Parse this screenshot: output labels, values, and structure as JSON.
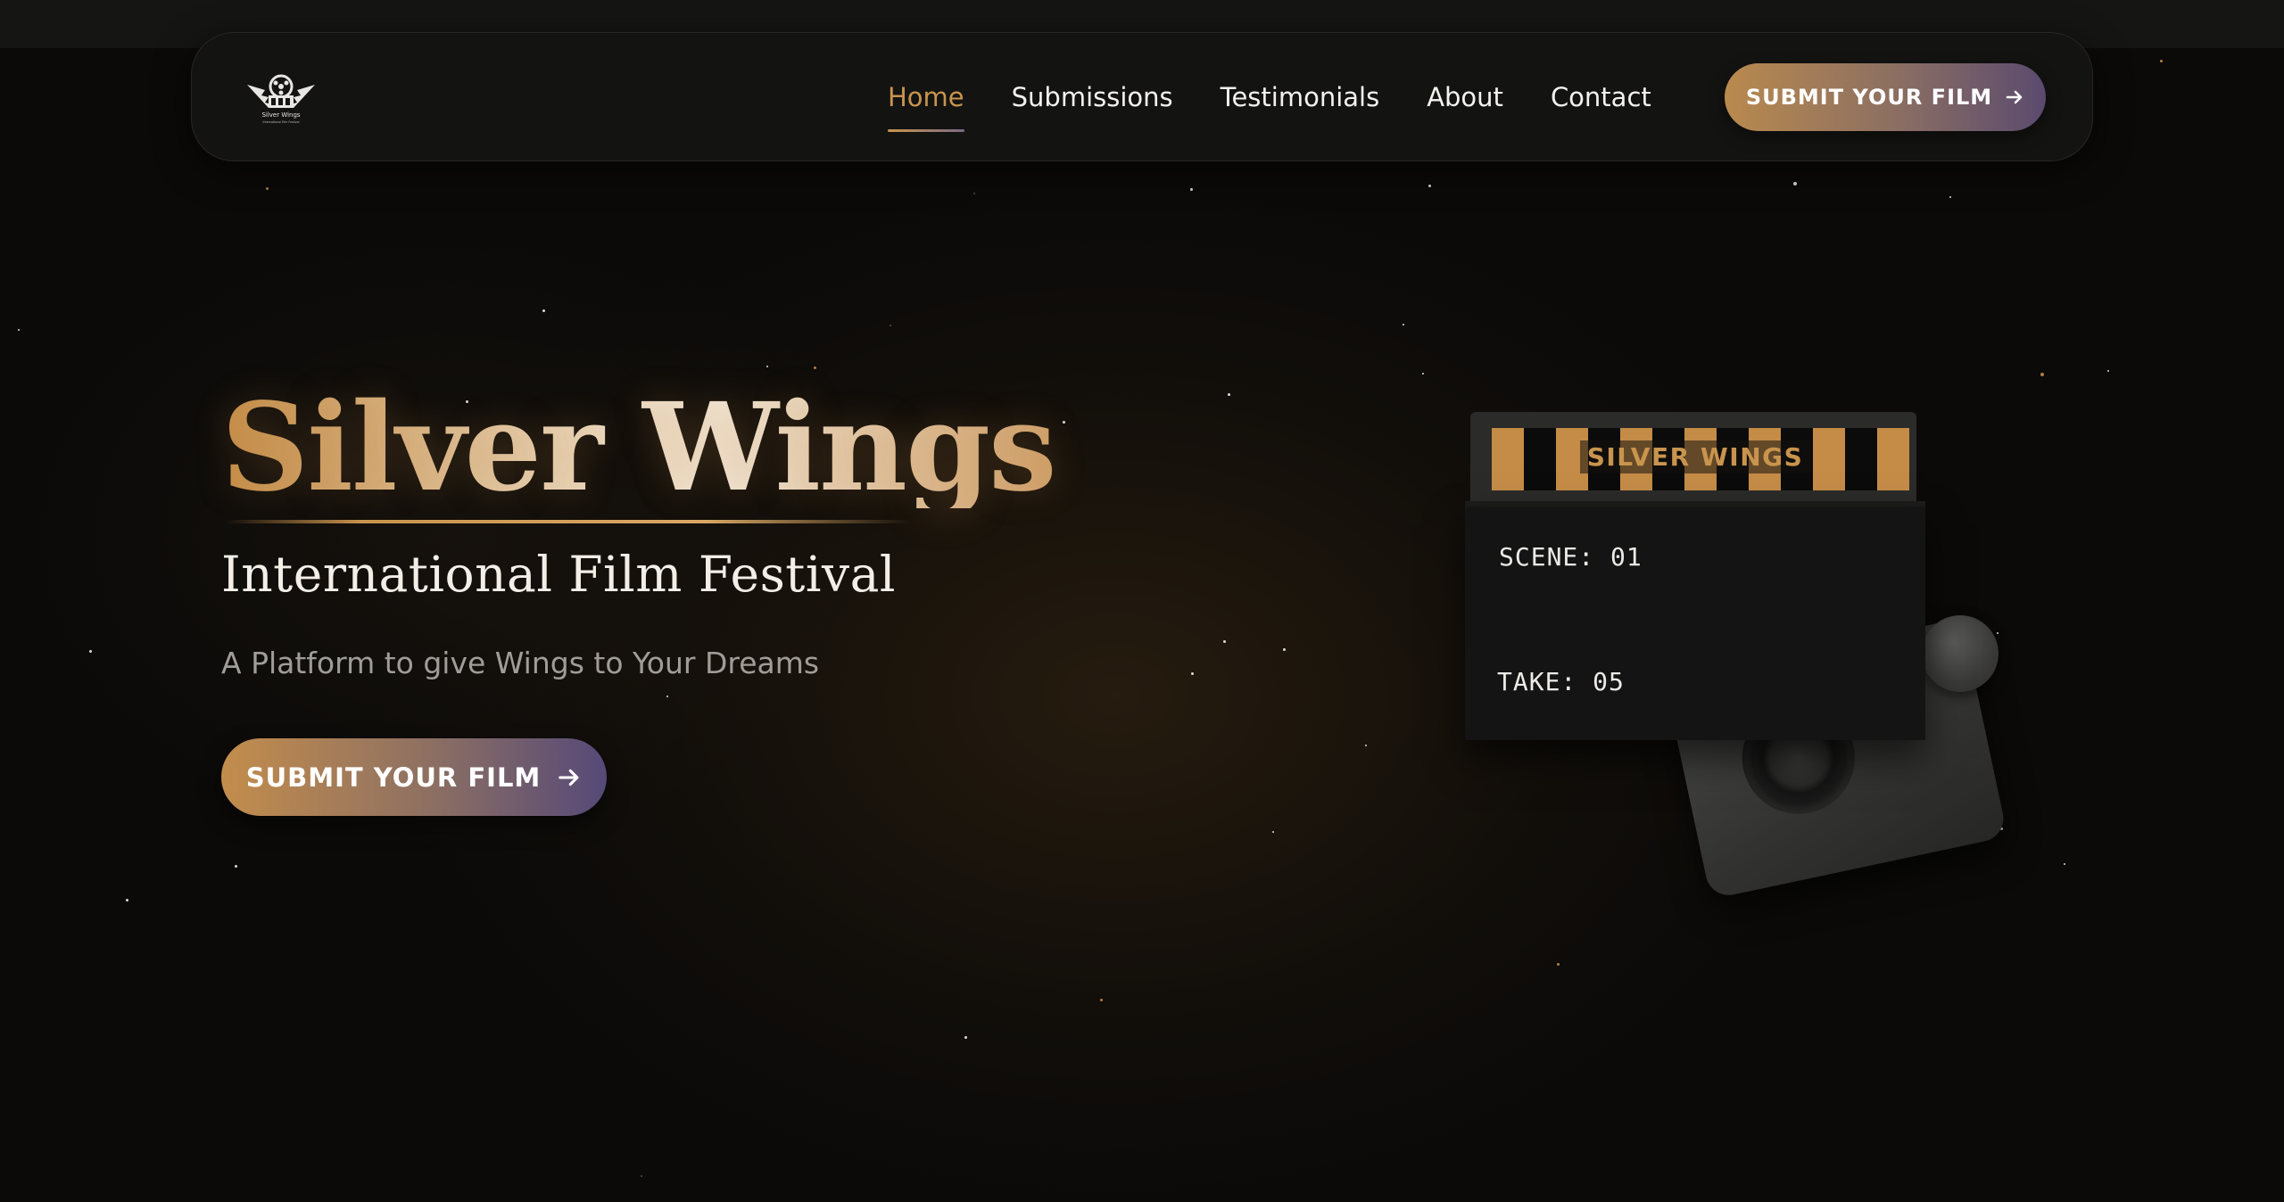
{
  "nav": {
    "logo_name": "Silver Wings",
    "logo_subtitle": "International Film Festival",
    "links": [
      {
        "label": "Home",
        "active": true
      },
      {
        "label": "Submissions",
        "active": false
      },
      {
        "label": "Testimonials",
        "active": false
      },
      {
        "label": "About",
        "active": false
      },
      {
        "label": "Contact",
        "active": false
      }
    ],
    "cta_label": "SUBMIT YOUR FILM",
    "cta_icon": "arrow-right-icon"
  },
  "hero": {
    "title": "Silver Wings",
    "subtitle": "International Film Festival",
    "tagline": "A Platform to give Wings to Your Dreams",
    "cta_label": "SUBMIT YOUR FILM",
    "cta_icon": "arrow-right-icon"
  },
  "clapperboard": {
    "label": "SILVER WINGS",
    "scene": "SCENE: 01",
    "take": "TAKE: 05"
  },
  "colors": {
    "accent_gold": "#c9944d",
    "accent_purple": "#554978",
    "background": "#0b0a09",
    "text": "#f3efe8",
    "muted_text": "#a09d99"
  }
}
